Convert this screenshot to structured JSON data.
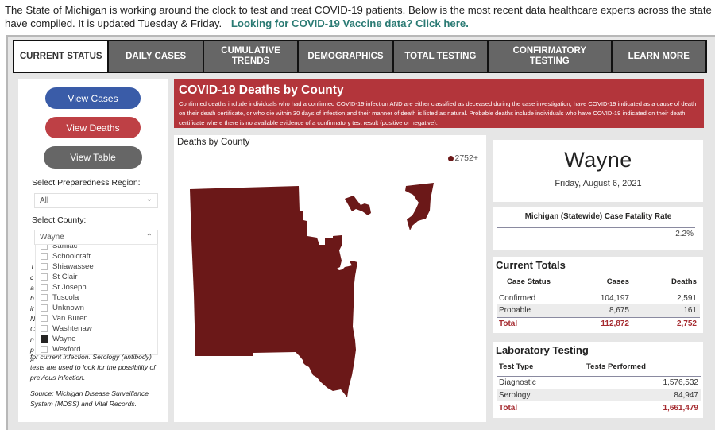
{
  "intro": {
    "text": "The State of Michigan is working around the clock to test and treat COVID-19 patients. Below is the most recent data healthcare experts across the state have compiled. It is updated Tuesday & Friday.",
    "link": "Looking for COVID-19 Vaccine data?  Click here."
  },
  "tabs": [
    {
      "label": "CURRENT STATUS",
      "active": true
    },
    {
      "label": "DAILY CASES",
      "active": false
    },
    {
      "label": "CUMULATIVE TRENDS",
      "active": false
    },
    {
      "label": "DEMOGRAPHICS",
      "active": false
    },
    {
      "label": "TOTAL TESTING",
      "active": false
    },
    {
      "label": "CONFIRMATORY TESTING",
      "active": false
    },
    {
      "label": "LEARN MORE",
      "active": false
    }
  ],
  "left_panel": {
    "buttons": {
      "view_cases": "View Cases",
      "view_deaths": "View Deaths",
      "view_table": "View Table"
    },
    "region_label": "Select Preparedness Region:",
    "region_value": "All",
    "county_label": "Select County:",
    "county_value": "Wayne",
    "county_options": [
      {
        "name": "Sanilac",
        "checked": false
      },
      {
        "name": "Schoolcraft",
        "checked": false
      },
      {
        "name": "Shiawassee",
        "checked": false
      },
      {
        "name": "St Clair",
        "checked": false
      },
      {
        "name": "St Joseph",
        "checked": false
      },
      {
        "name": "Tuscola",
        "checked": false
      },
      {
        "name": "Unknown",
        "checked": false
      },
      {
        "name": "Van Buren",
        "checked": false
      },
      {
        "name": "Washtenaw",
        "checked": false
      },
      {
        "name": "Wayne",
        "checked": true
      },
      {
        "name": "Wexford",
        "checked": false
      }
    ],
    "hidden_note_letters": [
      "T",
      "c",
      "a",
      "b",
      "ir",
      "N",
      "C",
      "n",
      "p",
      "a"
    ],
    "note_tail": "for current infection. Serology (antibody) tests are used to look for the possibility of previous infection.",
    "source": "Source: Michigan Disease Surveillance System (MDSS) and Vital Records."
  },
  "banner": {
    "title": "COVID-19 Deaths by County",
    "desc_before": "Confirmed deaths include individuals who had a confirmed COVID-19 infection ",
    "desc_emph": "AND",
    "desc_after": " are either classified as deceased during the case investigation, have COVID-19 indicated as a cause of death on their death certificate, or who die within 30 days of infection and their manner of death is listed as natural. Probable deaths include individuals who have COVID-19 indicated on their death certificate where there is no available evidence of a confirmatory test result (positive or negative)."
  },
  "map": {
    "title": "Deaths by County",
    "legend_label": "2752+",
    "fill_color": "#6b1818"
  },
  "county_card": {
    "name": "Wayne",
    "date": "Friday, August 6, 2021"
  },
  "cfr": {
    "title": "Michigan (Statewide) Case Fatality Rate",
    "value": "2.2%"
  },
  "current_totals": {
    "title": "Current Totals",
    "headers": [
      "Case Status",
      "Cases",
      "Deaths"
    ],
    "rows": [
      [
        "Confirmed",
        "104,197",
        "2,591"
      ],
      [
        "Probable",
        "8,675",
        "161"
      ]
    ],
    "total": [
      "Total",
      "112,872",
      "2,752"
    ]
  },
  "lab_testing": {
    "title": "Laboratory Testing",
    "headers": [
      "Test Type",
      "Tests Performed"
    ],
    "rows": [
      [
        "Diagnostic",
        "1,576,532"
      ],
      [
        "Serology",
        "84,947"
      ]
    ],
    "total": [
      "Total",
      "1,661,479"
    ]
  },
  "colors": {
    "accent_red": "#b3353b",
    "total_red": "#a52a2f",
    "cases_blue": "#3a5ca8",
    "deaths_red": "#be4045",
    "table_gray": "#666666"
  }
}
